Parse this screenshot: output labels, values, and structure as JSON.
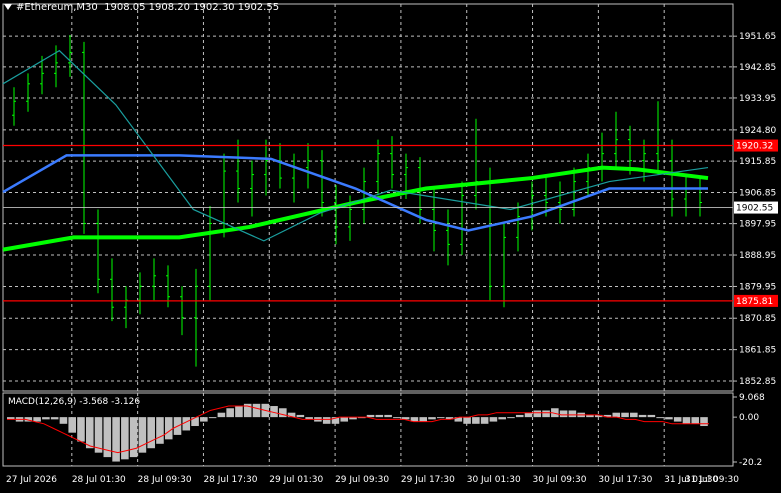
{
  "header": {
    "symbol": "#Ethereum,M30",
    "ohlc": "1908.05 1908.20 1902.30 1902.55"
  },
  "chart_data": [
    {
      "type": "candlestick",
      "symbol": "#Ethereum",
      "timeframe": "M30",
      "ylim": [
        1850.0,
        1958.0
      ],
      "price_ticks": [
        "1951.65",
        "1942.85",
        "1933.95",
        "1924.80",
        "1915.85",
        "1906.85",
        "1897.95",
        "1888.95",
        "1879.95",
        "1870.85",
        "1861.85",
        "1852.85"
      ],
      "time_labels": [
        "27 Jul 2026",
        "28 Jul 01:30",
        "28 Jul 09:30",
        "28 Jul 17:30",
        "29 Jul 01:30",
        "29 Jul 09:30",
        "29 Jul 17:30",
        "30 Jul 01:30",
        "30 Jul 09:30",
        "30 Jul 17:30",
        "31 Jul 01:30",
        "31 Jul 09:30"
      ],
      "horizontal_lines": [
        {
          "label": "1920.32",
          "value": 1920.32,
          "color": "#ff0000"
        },
        {
          "label": "1875.81",
          "value": 1875.81,
          "color": "#ff0000"
        }
      ],
      "current_price": {
        "label": "1902.55",
        "value": 1902.55,
        "color": "#ffffff"
      },
      "candle_color": "#00ff00",
      "moving_averages": [
        {
          "color": "#00ff00",
          "points": [
            [
              0,
              1890.5
            ],
            [
              0.1,
              1894
            ],
            [
              0.25,
              1894
            ],
            [
              0.35,
              1897
            ],
            [
              0.5,
              1904
            ],
            [
              0.6,
              1908
            ],
            [
              0.75,
              1911
            ],
            [
              0.85,
              1914
            ],
            [
              0.9,
              1913.5
            ],
            [
              1,
              1911
            ]
          ]
        },
        {
          "color": "#3b7bff",
          "points": [
            [
              0,
              1907
            ],
            [
              0.09,
              1917.5
            ],
            [
              0.25,
              1917.5
            ],
            [
              0.38,
              1916.5
            ],
            [
              0.5,
              1908
            ],
            [
              0.6,
              1899
            ],
            [
              0.66,
              1896
            ],
            [
              0.75,
              1900
            ],
            [
              0.86,
              1908
            ],
            [
              1,
              1908
            ]
          ]
        },
        {
          "color": "#1a9e9e",
          "points": [
            [
              0,
              1938
            ],
            [
              0.08,
              1947.5
            ],
            [
              0.16,
              1932
            ],
            [
              0.27,
              1902
            ],
            [
              0.37,
              1893
            ],
            [
              0.45,
              1901
            ],
            [
              0.55,
              1907.5
            ],
            [
              0.72,
              1902
            ],
            [
              0.86,
              1910
            ],
            [
              1,
              1914
            ]
          ]
        }
      ],
      "ohlc_series": [
        [
          1929,
          1937,
          1926,
          1933
        ],
        [
          1933,
          1941,
          1930,
          1938
        ],
        [
          1938,
          1946,
          1935,
          1941
        ],
        [
          1941,
          1949,
          1937,
          1944
        ],
        [
          1944,
          1952,
          1940,
          1947
        ],
        [
          1947,
          1950,
          1895,
          1898
        ],
        [
          1898,
          1902,
          1878,
          1882
        ],
        [
          1882,
          1888,
          1870,
          1874
        ],
        [
          1874,
          1880,
          1868,
          1876
        ],
        [
          1876,
          1884,
          1872,
          1880
        ],
        [
          1880,
          1888,
          1876,
          1883
        ],
        [
          1883,
          1886,
          1874,
          1877
        ],
        [
          1877,
          1880,
          1866,
          1871
        ],
        [
          1871,
          1885,
          1857,
          1880
        ],
        [
          1880,
          1903,
          1876,
          1898
        ],
        [
          1898,
          1918,
          1894,
          1913
        ],
        [
          1913,
          1922,
          1904,
          1908
        ],
        [
          1908,
          1916,
          1900,
          1912
        ],
        [
          1912,
          1922,
          1906,
          1916
        ],
        [
          1916,
          1921,
          1908,
          1911
        ],
        [
          1911,
          1918,
          1904,
          1914
        ],
        [
          1914,
          1921,
          1908,
          1916
        ],
        [
          1916,
          1919,
          1900,
          1904
        ],
        [
          1904,
          1909,
          1892,
          1897
        ],
        [
          1897,
          1906,
          1893,
          1902
        ],
        [
          1902,
          1914,
          1898,
          1910
        ],
        [
          1910,
          1922,
          1906,
          1918
        ],
        [
          1918,
          1923,
          1908,
          1912
        ],
        [
          1912,
          1918,
          1905,
          1914
        ],
        [
          1914,
          1917,
          1898,
          1902
        ],
        [
          1902,
          1908,
          1890,
          1896
        ],
        [
          1896,
          1902,
          1886,
          1892
        ],
        [
          1892,
          1910,
          1889,
          1906
        ],
        [
          1906,
          1928,
          1902,
          1910
        ],
        [
          1910,
          1914,
          1876,
          1880
        ],
        [
          1880,
          1898,
          1874,
          1894
        ],
        [
          1894,
          1904,
          1890,
          1900
        ],
        [
          1900,
          1910,
          1896,
          1906
        ],
        [
          1906,
          1912,
          1900,
          1904
        ],
        [
          1904,
          1910,
          1898,
          1902
        ],
        [
          1902,
          1914,
          1900,
          1910
        ],
        [
          1910,
          1918,
          1906,
          1914
        ],
        [
          1914,
          1924,
          1910,
          1918
        ],
        [
          1918,
          1930,
          1914,
          1922
        ],
        [
          1922,
          1926,
          1912,
          1916
        ],
        [
          1916,
          1922,
          1910,
          1918
        ],
        [
          1918,
          1933,
          1912,
          1916
        ],
        [
          1916,
          1922,
          1900,
          1905
        ],
        [
          1905,
          1912,
          1900,
          1908
        ],
        [
          1908,
          1911,
          1900,
          1904
        ]
      ]
    },
    {
      "type": "macd",
      "title": "MACD(12,26,9)",
      "values_text": "-3.568 -3.126",
      "params": [
        12,
        26,
        9
      ],
      "macd": -3.568,
      "signal": [
        -1,
        -1,
        -1,
        -2,
        -3,
        -5,
        -7,
        -9,
        -11,
        -13,
        -14,
        -15,
        -16,
        -15,
        -14,
        -12,
        -10,
        -8,
        -5,
        -3,
        -1,
        1,
        3,
        4,
        5,
        5,
        5,
        4,
        3,
        2,
        1,
        0,
        -1,
        -1,
        -1,
        -1,
        0,
        0,
        0,
        0,
        -1,
        -1,
        -1,
        -1,
        -2,
        -2,
        -2,
        -1,
        -1,
        0,
        0,
        1,
        1,
        2,
        2,
        2,
        2,
        2,
        2,
        2,
        1,
        1,
        1,
        1,
        1,
        0,
        0,
        -1,
        -1,
        -2,
        -2,
        -2,
        -3,
        -3,
        -3,
        -3,
        -3
      ],
      "ylim": [
        -20.2,
        9.068
      ],
      "ticks": [
        "9.068",
        "0.00",
        "-20.2"
      ],
      "histogram_color": "#c0c0c0",
      "signal_color": "#ff0000",
      "histogram": [
        -1,
        -2,
        -2,
        -2,
        -1,
        -1,
        -3,
        -7,
        -11,
        -14,
        -16,
        -18,
        -20,
        -19,
        -18,
        -16,
        -14,
        -12,
        -10,
        -8,
        -6,
        -4,
        -2,
        0,
        2,
        4,
        5,
        6,
        6,
        6,
        5,
        4,
        2,
        1,
        -1,
        -2,
        -3,
        -3,
        -2,
        -1,
        0,
        1,
        1,
        1,
        0,
        -1,
        -2,
        -2,
        -1,
        0,
        -1,
        -2,
        -3,
        -3,
        -3,
        -2,
        -1,
        0,
        1,
        2,
        3,
        3,
        4,
        3,
        3,
        2,
        1,
        1,
        1,
        2,
        2,
        2,
        1,
        1,
        0,
        -1,
        -2,
        -3,
        -3,
        -4
      ]
    }
  ]
}
